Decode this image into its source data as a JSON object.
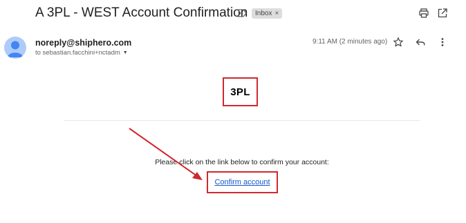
{
  "email": {
    "subject": "A 3PL - WEST Account Confirmation",
    "label_chip": "Inbox",
    "label_chip_close": "×"
  },
  "sender": {
    "address": "noreply@shiphero.com",
    "recipient_line": "to sebastian.facchini+nctadm",
    "recipient_caret": "▼",
    "timestamp": "9:11 AM (2 minutes ago)"
  },
  "icons": {
    "important": "label-important-icon",
    "print": "print-icon",
    "popout": "open-in-new-window-icon",
    "avatar": "default-avatar-icon",
    "star": "star-icon",
    "reply": "reply-icon",
    "more": "more-vert-icon"
  },
  "body": {
    "logo_text": "3PL",
    "message": "Please click on the link below to confirm your account:",
    "confirm_link": "Confirm account"
  },
  "colors": {
    "annotation_red": "#d0282d",
    "link_blue": "#1155cc",
    "avatar_bg": "#aecbfa",
    "avatar_fg": "#4285f4"
  }
}
